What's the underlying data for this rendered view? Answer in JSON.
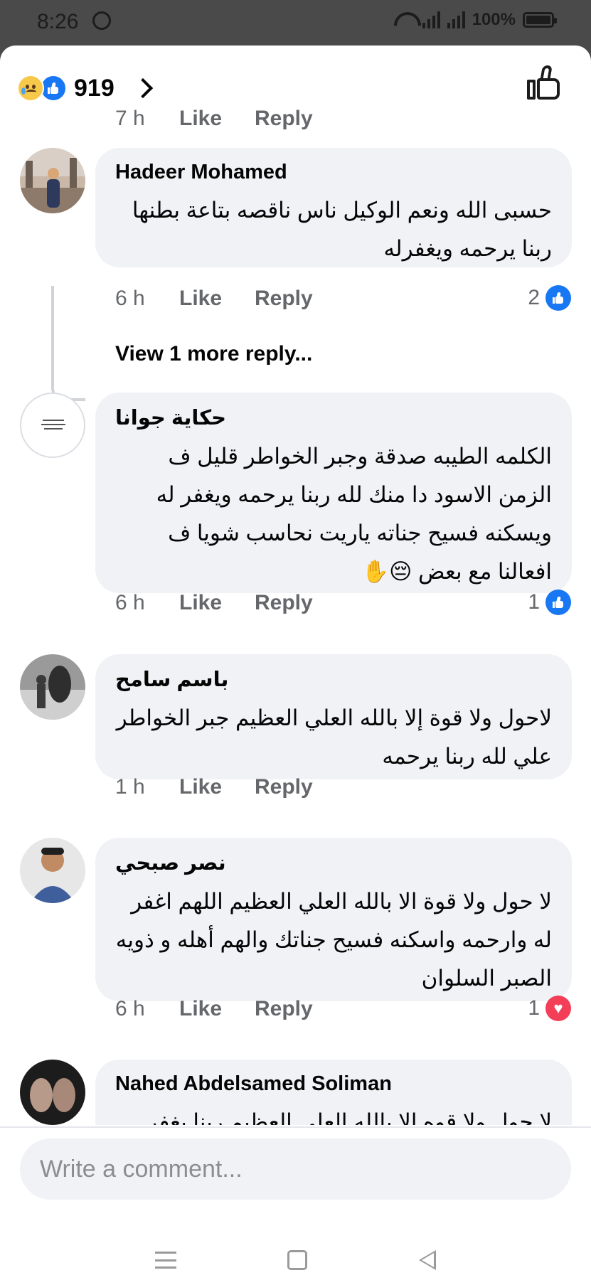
{
  "status": {
    "time": "8:26",
    "battery": "100%"
  },
  "reactions": {
    "count": "919"
  },
  "top_meta": {
    "time": "7 h",
    "like": "Like",
    "reply": "Reply"
  },
  "comments": [
    {
      "name": "Hadeer Mohamed",
      "text": "حسبى الله ونعم الوكيل ناس ناقصه بتاعة بطنها ربنا يرحمه ويغفرله",
      "time": "6 h",
      "like": "Like",
      "reply": "Reply",
      "reactions": "2",
      "reaction_type": "like"
    },
    {
      "name": "حكاية جوانا",
      "text": "الكلمه الطيبه صدقة وجبر الخواطر قليل ف الزمن الاسود دا منك لله ربنا يرحمه ويغفر له ويسكنه فسيح جناته ياريت نحاسب شويا ف افعالنا مع بعض 😔✋",
      "time": "6 h",
      "like": "Like",
      "reply": "Reply",
      "reactions": "1",
      "reaction_type": "like"
    },
    {
      "name": "باسم سامح",
      "text": "لاحول ولا قوة إلا بالله العلي العظيم جبر الخواطر علي لله ربنا يرحمه",
      "time": "1 h",
      "like": "Like",
      "reply": "Reply",
      "reactions": "",
      "reaction_type": ""
    },
    {
      "name": "نصر صبحي",
      "text": "لا حول ولا قوة الا بالله العلي العظيم اللهم اغفر له وارحمه واسكنه فسيح جناتك والهم أهله و ذويه الصبر السلوان",
      "time": "6 h",
      "like": "Like",
      "reply": "Reply",
      "reactions": "1",
      "reaction_type": "love"
    },
    {
      "name": "Nahed Abdelsamed Soliman",
      "text": "لا حول ولا قوه الا بالله العلي العظيم ربنا يغفر"
    }
  ],
  "view_more": "View 1 more reply...",
  "composer": {
    "placeholder": "Write a comment..."
  },
  "colors": {
    "like_blue": "#1877f2",
    "love_red": "#f33e58",
    "bubble": "#f0f2f5",
    "meta_gray": "#65676b"
  }
}
